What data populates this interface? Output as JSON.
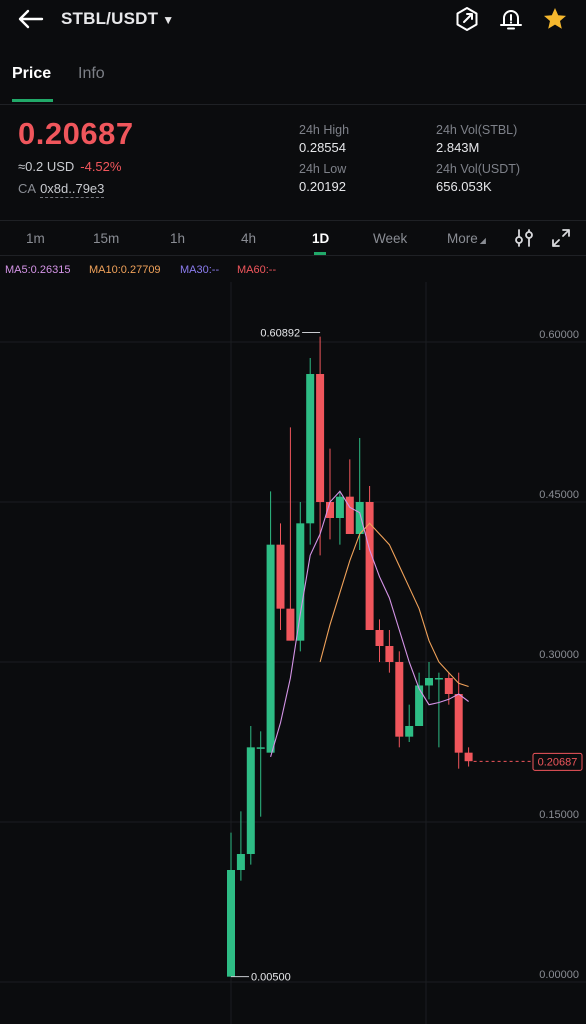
{
  "header": {
    "pair": "STBL/USDT",
    "icons": [
      "back-arrow-icon",
      "share-icon",
      "alert-bell-icon",
      "favorite-star-icon"
    ],
    "star_color": "#f5b82e"
  },
  "tabs": [
    {
      "label": "Price",
      "active": true
    },
    {
      "label": "Info",
      "active": false
    }
  ],
  "ticker": {
    "last_price": "0.20687",
    "usd_value": "≈0.2 USD",
    "change": "-4.52%",
    "ca_label": "CA",
    "ca_value": "0x8d..79e3",
    "high_label": "24h High",
    "high_value": "0.28554",
    "low_label": "24h Low",
    "low_value": "0.20192",
    "vol_base_label": "24h Vol(STBL)",
    "vol_base_value": "2.843M",
    "vol_quote_label": "24h Vol(USDT)",
    "vol_quote_value": "656.053K"
  },
  "intervals": [
    {
      "label": "1m",
      "active": false
    },
    {
      "label": "15m",
      "active": false
    },
    {
      "label": "1h",
      "active": false
    },
    {
      "label": "4h",
      "active": false
    },
    {
      "label": "1D",
      "active": true
    },
    {
      "label": "Week",
      "active": false
    },
    {
      "label": "More",
      "active": false
    }
  ],
  "interval_icons": [
    "indicator-settings-icon",
    "fullscreen-icon"
  ],
  "indicators": {
    "ma5": "MA5:0.26315",
    "ma10": "MA10:0.27709",
    "ma30": "MA30:--",
    "ma60": "MA60:--"
  },
  "colors": {
    "up": "#2ebd85",
    "down": "#f0565c",
    "accent": "#21a969",
    "ma5": "#d494e6",
    "ma10": "#f0a25a",
    "ma30": "#8c7df0",
    "ma60": "#f0565c"
  },
  "chart_data": {
    "type": "candlestick",
    "ylim": [
      0.0,
      0.6
    ],
    "y_ticks": [
      "0.60000",
      "0.45000",
      "0.30000",
      "0.15000",
      "0.00000"
    ],
    "y_tick_values": [
      0.6,
      0.45,
      0.3,
      0.15,
      0.0
    ],
    "max_label": "0.60892",
    "max_value": 0.60892,
    "min_label": "0.00500",
    "min_value": 0.005,
    "last_price_label": "0.20687",
    "last_price": 0.20687,
    "candles": [
      {
        "o": 0.005,
        "h": 0.14,
        "l": 0.005,
        "c": 0.105
      },
      {
        "o": 0.105,
        "h": 0.16,
        "l": 0.095,
        "c": 0.12
      },
      {
        "o": 0.12,
        "h": 0.24,
        "l": 0.11,
        "c": 0.22
      },
      {
        "o": 0.22,
        "h": 0.235,
        "l": 0.155,
        "c": 0.22
      },
      {
        "o": 0.215,
        "h": 0.46,
        "l": 0.215,
        "c": 0.41
      },
      {
        "o": 0.41,
        "h": 0.43,
        "l": 0.33,
        "c": 0.35
      },
      {
        "o": 0.35,
        "h": 0.52,
        "l": 0.32,
        "c": 0.32
      },
      {
        "o": 0.32,
        "h": 0.45,
        "l": 0.31,
        "c": 0.43
      },
      {
        "o": 0.43,
        "h": 0.585,
        "l": 0.41,
        "c": 0.57
      },
      {
        "o": 0.57,
        "h": 0.605,
        "l": 0.4,
        "c": 0.45
      },
      {
        "o": 0.45,
        "h": 0.5,
        "l": 0.415,
        "c": 0.435
      },
      {
        "o": 0.435,
        "h": 0.46,
        "l": 0.41,
        "c": 0.455
      },
      {
        "o": 0.455,
        "h": 0.49,
        "l": 0.42,
        "c": 0.42
      },
      {
        "o": 0.42,
        "h": 0.51,
        "l": 0.405,
        "c": 0.45
      },
      {
        "o": 0.45,
        "h": 0.465,
        "l": 0.4,
        "c": 0.33
      },
      {
        "o": 0.33,
        "h": 0.34,
        "l": 0.3,
        "c": 0.315
      },
      {
        "o": 0.315,
        "h": 0.33,
        "l": 0.29,
        "c": 0.3
      },
      {
        "o": 0.3,
        "h": 0.31,
        "l": 0.22,
        "c": 0.23
      },
      {
        "o": 0.23,
        "h": 0.26,
        "l": 0.225,
        "c": 0.24
      },
      {
        "o": 0.24,
        "h": 0.29,
        "l": 0.24,
        "c": 0.278
      },
      {
        "o": 0.278,
        "h": 0.3,
        "l": 0.265,
        "c": 0.285
      },
      {
        "o": 0.285,
        "h": 0.29,
        "l": 0.22,
        "c": 0.285
      },
      {
        "o": 0.285,
        "h": 0.29,
        "l": 0.26,
        "c": 0.27
      },
      {
        "o": 0.27,
        "h": 0.29,
        "l": 0.2,
        "c": 0.215
      },
      {
        "o": 0.215,
        "h": 0.22,
        "l": 0.202,
        "c": 0.207
      }
    ],
    "ma5": [
      null,
      null,
      null,
      null,
      0.211,
      0.243,
      0.285,
      0.345,
      0.4,
      0.42,
      0.45,
      0.46,
      0.445,
      0.44,
      0.405,
      0.38,
      0.36,
      0.33,
      0.3,
      0.275,
      0.26,
      0.262,
      0.265,
      0.27,
      0.263
    ],
    "ma10": [
      null,
      null,
      null,
      null,
      null,
      null,
      null,
      null,
      null,
      0.3,
      0.335,
      0.365,
      0.395,
      0.42,
      0.43,
      0.42,
      0.41,
      0.39,
      0.37,
      0.35,
      0.32,
      0.3,
      0.29,
      0.28,
      0.277
    ]
  }
}
